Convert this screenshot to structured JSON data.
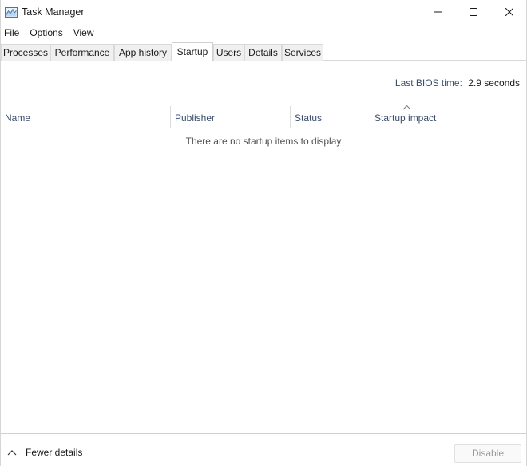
{
  "window": {
    "title": "Task Manager"
  },
  "menu": [
    "File",
    "Options",
    "View"
  ],
  "tabs": [
    "Processes",
    "Performance",
    "App history",
    "Startup",
    "Users",
    "Details",
    "Services"
  ],
  "active_tab": "Startup",
  "bios": {
    "label": "Last BIOS time:",
    "value": "2.9 seconds"
  },
  "columns": [
    "Name",
    "Publisher",
    "Status",
    "Startup impact"
  ],
  "sorted_column": "Startup impact",
  "empty_message": "There are no startup items to display",
  "footer": {
    "fewer_details": "Fewer details",
    "disable": "Disable"
  },
  "icons": {
    "app": "task-manager-icon",
    "minimize": "minimize-icon",
    "maximize": "maximize-icon",
    "close": "close-icon",
    "sort": "sort-ascending-icon",
    "fewer": "chevron-up-icon"
  },
  "colors": {
    "accent_text": "#3a4e6c",
    "disabled_text": "#9a9a9a"
  }
}
